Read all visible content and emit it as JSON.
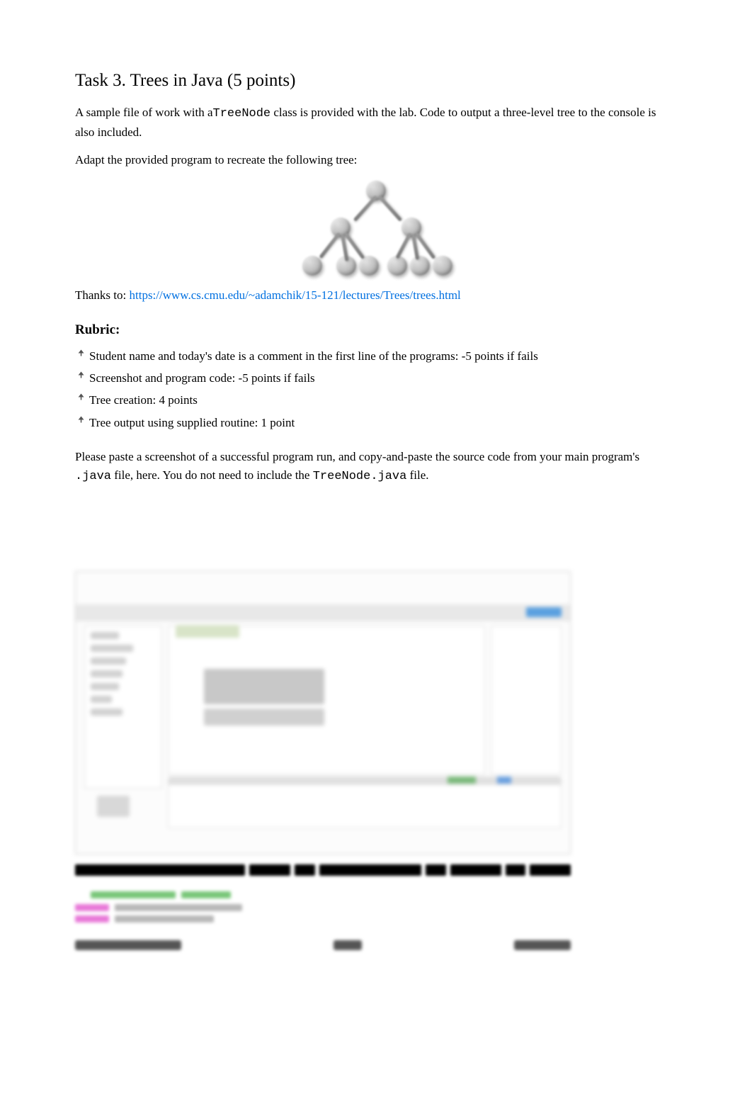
{
  "task": {
    "heading": "Task 3. Trees in Java (5 points)",
    "p1_pre": "A sample file of work with a",
    "p1_code": "TreeNode",
    "p1_post": " class is provided with the lab. Code to output a three-level tree to the console is also included.",
    "p2": "Adapt the provided program to recreate the following tree:",
    "thanks_label": "Thanks to: ",
    "thanks_url": "https://www.cs.cmu.edu/~adamchik/15-121/lectures/Trees/trees.html"
  },
  "rubric": {
    "heading": "Rubric:",
    "items": [
      "Student name and today's date is a comment in the first line of the programs: -5 points if fails",
      "Screenshot and program code: -5 points if fails",
      "Tree creation: 4 points",
      "Tree output using supplied routine: 1 point"
    ]
  },
  "paste": {
    "pre": "Please paste a screenshot of a successful program run, and copy-and-paste the source code from your main program's ",
    "code1": ".java",
    "mid": " file, here. You do not need to include the ",
    "code2": "TreeNode.java",
    "post": " file."
  }
}
